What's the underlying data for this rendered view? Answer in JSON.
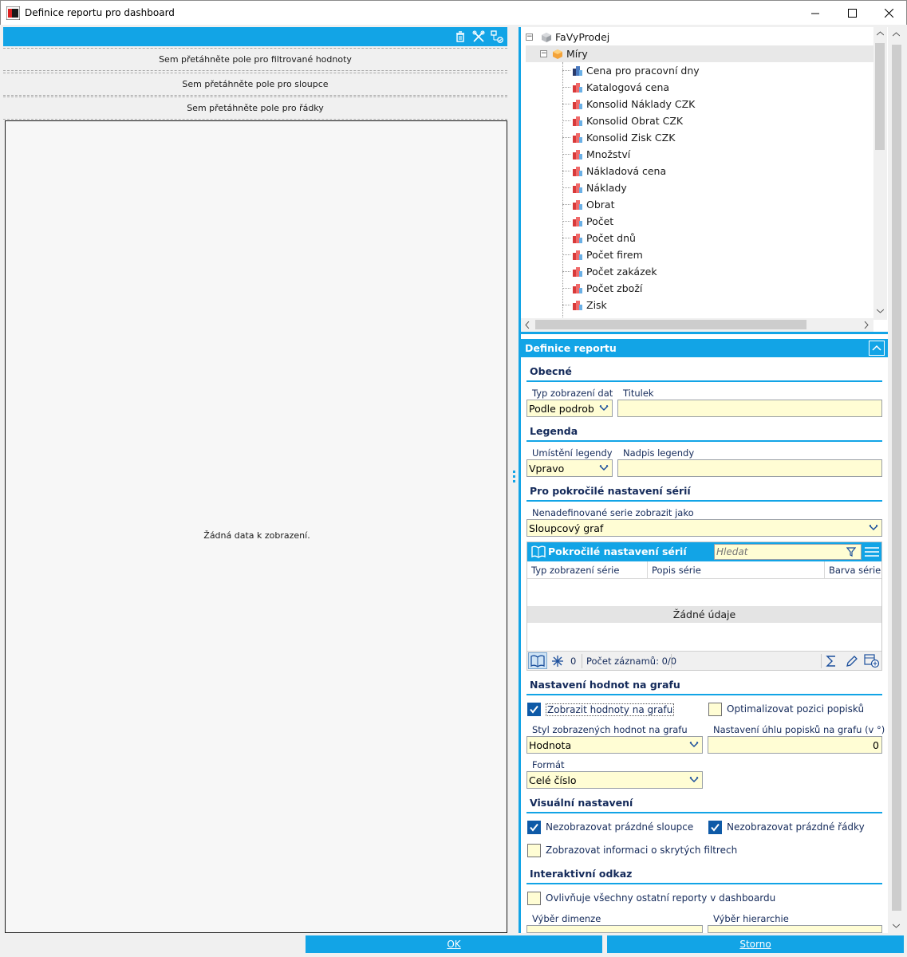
{
  "window": {
    "title": "Definice reportu pro dashboard"
  },
  "left_panel": {
    "dropzones": {
      "filters": "Sem přetáhněte pole pro filtrované hodnoty",
      "columns": "Sem přetáhněte pole pro sloupce",
      "rows": "Sem přetáhněte pole pro řádky"
    },
    "empty_text": "Žádná data k zobrazení."
  },
  "tree": {
    "root": "FaVyProdej",
    "group": "Míry",
    "items": [
      "Cena pro pracovní dny",
      "Katalogová cena",
      "Konsolid Náklady CZK",
      "Konsolid Obrat CZK",
      "Konsolid Zisk CZK",
      "Množství",
      "Nákladová cena",
      "Náklady",
      "Obrat",
      "Počet",
      "Počet dnů",
      "Počet firem",
      "Počet zakázek",
      "Počet zboží",
      "Zisk"
    ]
  },
  "report": {
    "header": "Definice reportu",
    "general": {
      "title": "Obecné",
      "type_label": "Typ zobrazení dat",
      "type_value": "Podle podrob",
      "titulek_label": "Titulek",
      "titulek_value": ""
    },
    "legend": {
      "title": "Legenda",
      "position_label": "Umístění legendy",
      "position_value": "Vpravo",
      "caption_label": "Nadpis legendy",
      "caption_value": ""
    },
    "series": {
      "title": "Pro pokročilé nastavení sérií",
      "undefined_label": "Nenadefinované serie zobrazit jako",
      "undefined_value": "Sloupcový graf",
      "grid_title": "Pokročilé nastavení sérií",
      "search_placeholder": "Hledat",
      "columns": [
        "Typ zobrazení série",
        "Popis série",
        "Barva série"
      ],
      "empty_text": "Žádné údaje",
      "freeze_count": "0",
      "record_count": "Počet záznamů: 0/0"
    },
    "values": {
      "title": "Nastavení hodnot na grafu",
      "show_values_label": "Zobrazit hodnoty na grafu",
      "show_values": true,
      "optimize_label": "Optimalizovat pozici popisků",
      "optimize": false,
      "style_label": "Styl zobrazených hodnot na grafu",
      "style_value": "Hodnota",
      "angle_label": "Nastavení úhlu popisků na grafu (v °)",
      "angle_value": "0",
      "format_label": "Formát",
      "format_value": "Celé číslo"
    },
    "visual": {
      "title": "Visuální nastavení",
      "hide_empty_cols_label": "Nezobrazovat prázdné sloupce",
      "hide_empty_cols": true,
      "hide_empty_rows_label": "Nezobrazovat prázdné řádky",
      "hide_empty_rows": true,
      "show_hidden_filters_label": "Zobrazovat informaci o skrytých filtrech",
      "show_hidden_filters": false
    },
    "interactive": {
      "title": "Interaktivní odkaz",
      "affects_label": "Ovlivňuje všechny ostatní reporty v dashboardu",
      "affects": false,
      "dimension_label": "Výběr dimenze",
      "hierarchy_label": "Výběr hierarchie"
    }
  },
  "buttons": {
    "ok": "OK",
    "cancel": "Storno"
  },
  "colors": {
    "accent": "#12a4e6",
    "field_bg": "#fffdd4",
    "label": "#142a5a"
  }
}
